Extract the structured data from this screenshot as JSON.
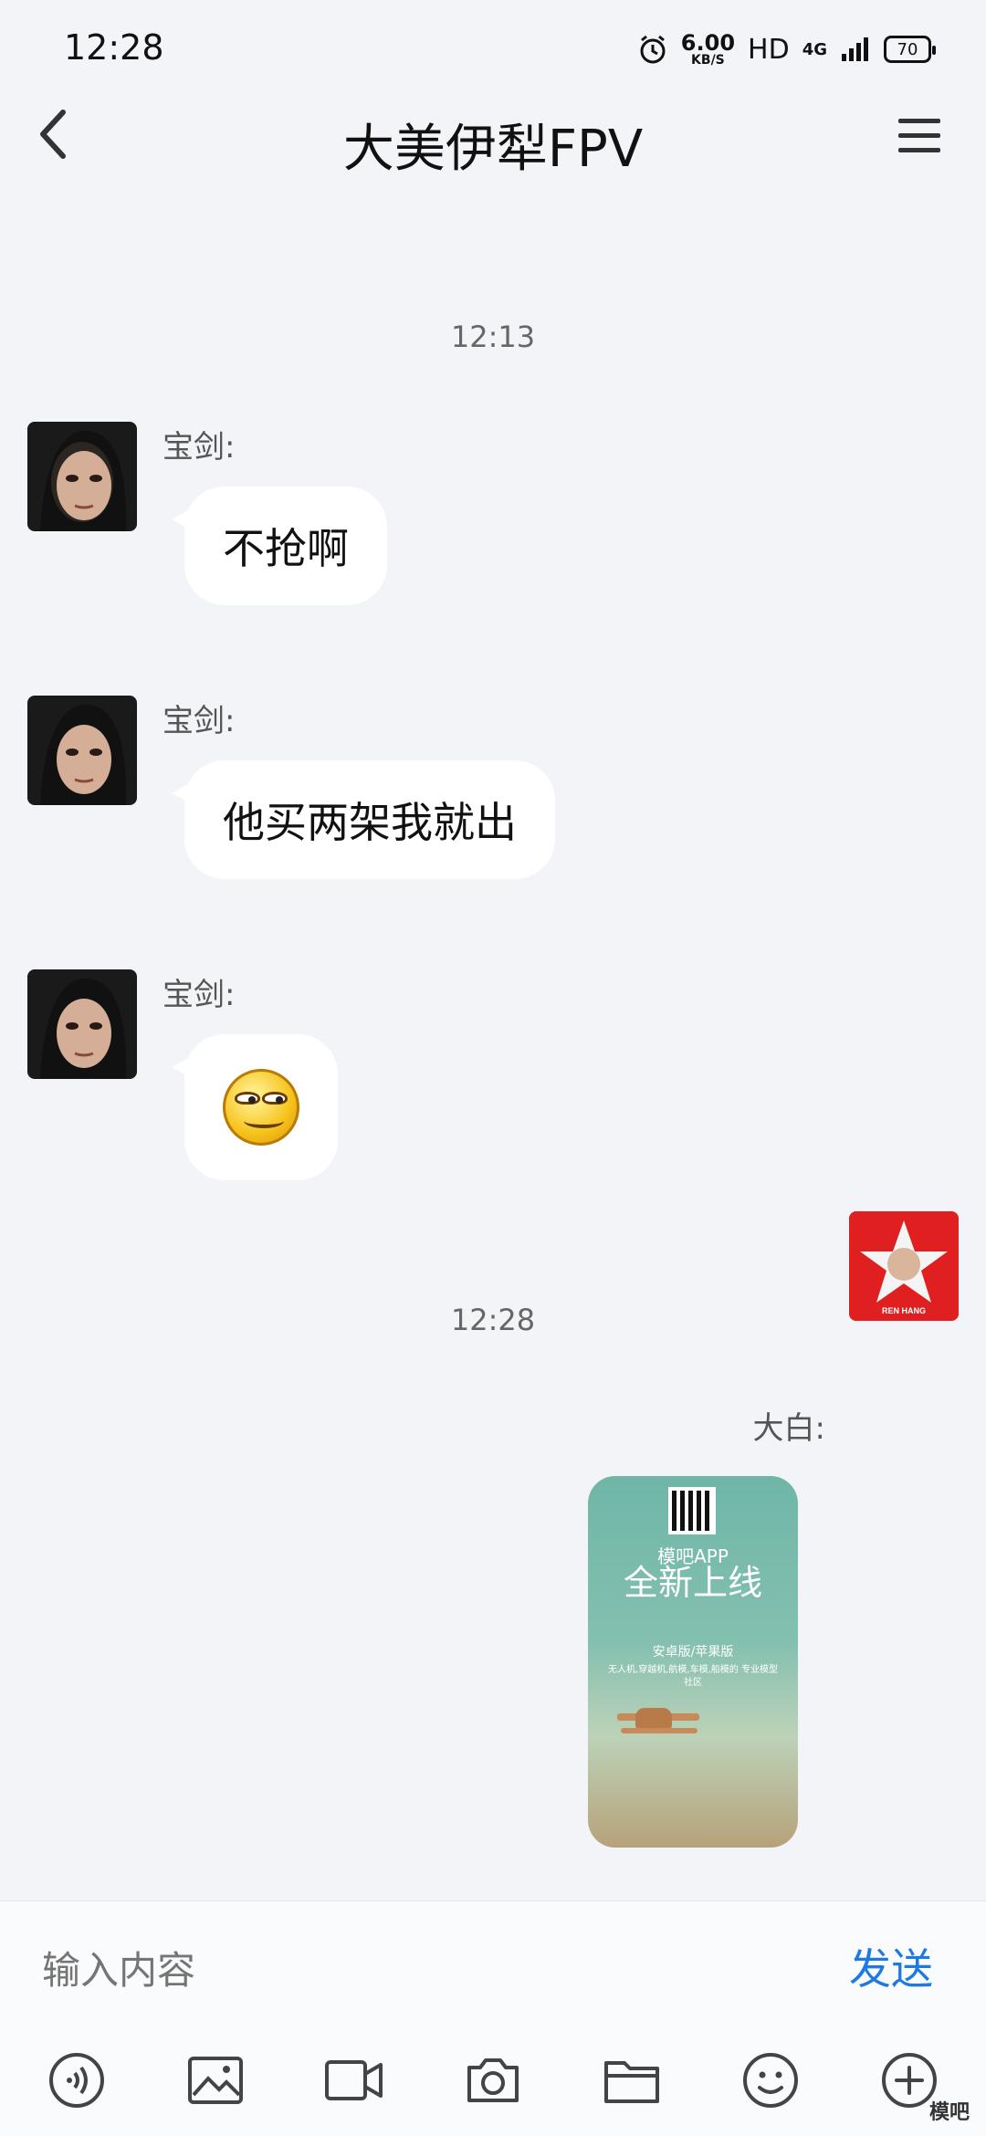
{
  "status_bar": {
    "time": "12:28",
    "speed_value": "6.00",
    "speed_unit": "KB/S",
    "hd": "HD",
    "network": "4G",
    "battery": "70"
  },
  "header": {
    "title": "大美伊犁FPV"
  },
  "chat": {
    "timestamps": [
      "12:13",
      "12:28"
    ],
    "messages": [
      {
        "sender": "宝剑:",
        "text": "不抢啊"
      },
      {
        "sender": "宝剑:",
        "text": "他买两架我就出"
      },
      {
        "sender": "宝剑:",
        "emoji": "smirk-emoji"
      },
      {
        "sender": "大白:",
        "image": {
          "line1": "模吧APP",
          "line2": "全新上线",
          "line3": "安卓版/苹果版",
          "line4": "无人机,穿越机,航模,车模,船模的 专业模型社区"
        },
        "avatar_text": "REN HANG"
      }
    ]
  },
  "input_bar": {
    "placeholder": "输入内容",
    "send_label": "发送",
    "tools": [
      "voice-icon",
      "image-icon",
      "video-icon",
      "camera-icon",
      "folder-icon",
      "emoji-icon",
      "plus-icon"
    ]
  },
  "watermark": "模吧"
}
